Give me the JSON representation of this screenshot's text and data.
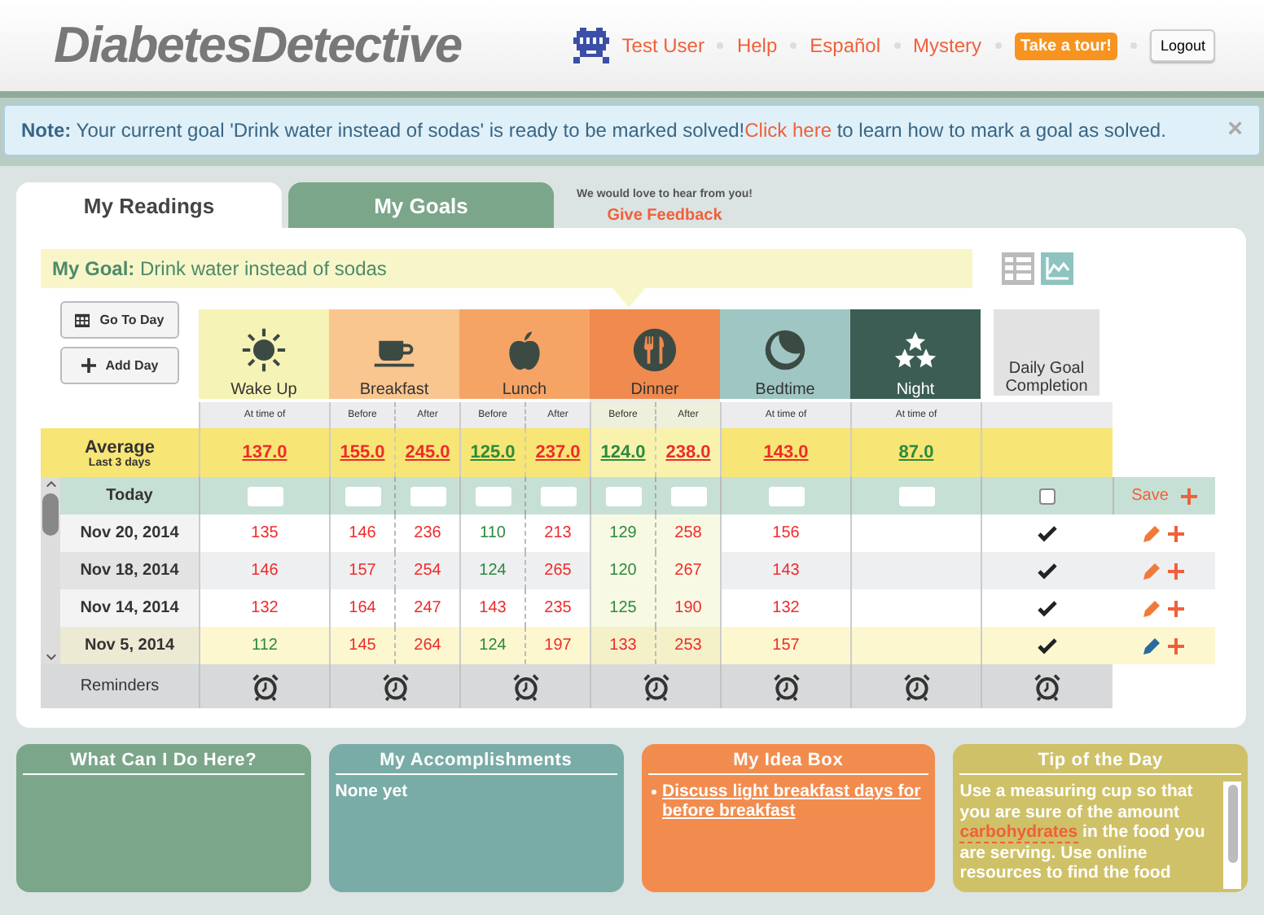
{
  "header": {
    "logo": "DiabetesDetective",
    "user": "Test User",
    "links": [
      "Help",
      "Español",
      "Mystery"
    ],
    "tour": "Take a tour!",
    "logout": "Logout"
  },
  "note": {
    "label": "Note:",
    "text": " Your current goal 'Drink water instead of sodas' is ready to be marked solved!",
    "link": "Click here",
    "text_after": " to learn how to mark a goal as solved.",
    "close": "×"
  },
  "tabs": [
    {
      "label": "My Readings",
      "selected": true
    },
    {
      "label": "My Goals",
      "selected": false
    }
  ],
  "feedback": {
    "prompt": "We would love to hear from you!",
    "link": "Give Feedback"
  },
  "goal": {
    "label": "My Goal:",
    "text": "Drink water instead of sodas"
  },
  "actions": [
    "Go To Day",
    "Add Day"
  ],
  "meals": [
    {
      "name": "Wake Up",
      "kind": "wake",
      "color": "#f6f3b6",
      "selected": false,
      "subs": [
        "At time of"
      ]
    },
    {
      "name": "Breakfast",
      "kind": "breakfast",
      "color": "#f9c68f",
      "selected": false,
      "subs": [
        "Before",
        "After"
      ]
    },
    {
      "name": "Lunch",
      "kind": "lunch",
      "color": "#f5a466",
      "selected": false,
      "subs": [
        "Before",
        "After"
      ]
    },
    {
      "name": "Dinner",
      "kind": "dinner",
      "color": "#f08a4e",
      "selected": true,
      "subs": [
        "Before",
        "After"
      ]
    },
    {
      "name": "Bedtime",
      "kind": "bedtime",
      "color": "#9fc6c3",
      "selected": false,
      "subs": [
        "At time of"
      ]
    },
    {
      "name": "Night",
      "kind": "night",
      "color": "#3b5d54",
      "selected": false,
      "subs": [
        "At time of"
      ]
    }
  ],
  "completion_header": "Daily Goal Completion",
  "average": {
    "label": "Average",
    "sub": "Last 3 days",
    "values": [
      {
        "value": "137.0",
        "high": true
      },
      {
        "value": "155.0",
        "high": true
      },
      {
        "value": "245.0",
        "high": true
      },
      {
        "value": "125.0",
        "high": false
      },
      {
        "value": "237.0",
        "high": true
      },
      {
        "value": "124.0",
        "high": false
      },
      {
        "value": "238.0",
        "high": true
      },
      {
        "value": "143.0",
        "high": true
      },
      {
        "value": "87.0",
        "high": false
      }
    ]
  },
  "today": {
    "label": "Today",
    "checked": false,
    "save": "Save"
  },
  "rows": [
    {
      "date": "Nov 20, 2014",
      "selected": false,
      "goal_met": true,
      "readings": [
        {
          "value": "135",
          "high": true
        },
        {
          "value": "146",
          "high": true
        },
        {
          "value": "236",
          "high": true
        },
        {
          "value": "110",
          "high": false
        },
        {
          "value": "213",
          "high": true
        },
        {
          "value": "129",
          "high": false
        },
        {
          "value": "258",
          "high": true
        },
        {
          "value": "156",
          "high": true
        }
      ]
    },
    {
      "date": "Nov 18, 2014",
      "selected": false,
      "goal_met": true,
      "readings": [
        {
          "value": "146",
          "high": true
        },
        {
          "value": "157",
          "high": true
        },
        {
          "value": "254",
          "high": true
        },
        {
          "value": "124",
          "high": false
        },
        {
          "value": "265",
          "high": true
        },
        {
          "value": "120",
          "high": false
        },
        {
          "value": "267",
          "high": true
        },
        {
          "value": "143",
          "high": true
        }
      ]
    },
    {
      "date": "Nov 14, 2014",
      "selected": false,
      "goal_met": true,
      "readings": [
        {
          "value": "132",
          "high": true
        },
        {
          "value": "164",
          "high": true
        },
        {
          "value": "247",
          "high": true
        },
        {
          "value": "143",
          "high": true
        },
        {
          "value": "235",
          "high": true
        },
        {
          "value": "125",
          "high": false
        },
        {
          "value": "190",
          "high": true
        },
        {
          "value": "132",
          "high": true
        }
      ]
    },
    {
      "date": "Nov 5, 2014",
      "selected": true,
      "goal_met": true,
      "readings": [
        {
          "value": "112",
          "high": false
        },
        {
          "value": "145",
          "high": true
        },
        {
          "value": "264",
          "high": true
        },
        {
          "value": "124",
          "high": false
        },
        {
          "value": "197",
          "high": true
        },
        {
          "value": "133",
          "high": true
        },
        {
          "value": "253",
          "high": true
        },
        {
          "value": "157",
          "high": true
        }
      ]
    }
  ],
  "reminders_label": "Reminders",
  "cards": [
    {
      "title": "What Can I Do Here?",
      "kind": "empty",
      "color": "#7ba68a"
    },
    {
      "title": "My Accomplishments",
      "kind": "text",
      "color": "#7aaca7",
      "text": "None yet"
    },
    {
      "title": "My Idea Box",
      "kind": "links",
      "color": "#f28c4e",
      "links": [
        "Discuss light breakfast days for before breakfast"
      ]
    },
    {
      "title": "Tip of the Day",
      "kind": "tip",
      "color": "#cfc168",
      "text": "Use a measuring cup so that you are sure of the amount ",
      "link": "carbohydrates",
      "text_after": " in the food you are serving. Use online resources to find the food"
    }
  ]
}
